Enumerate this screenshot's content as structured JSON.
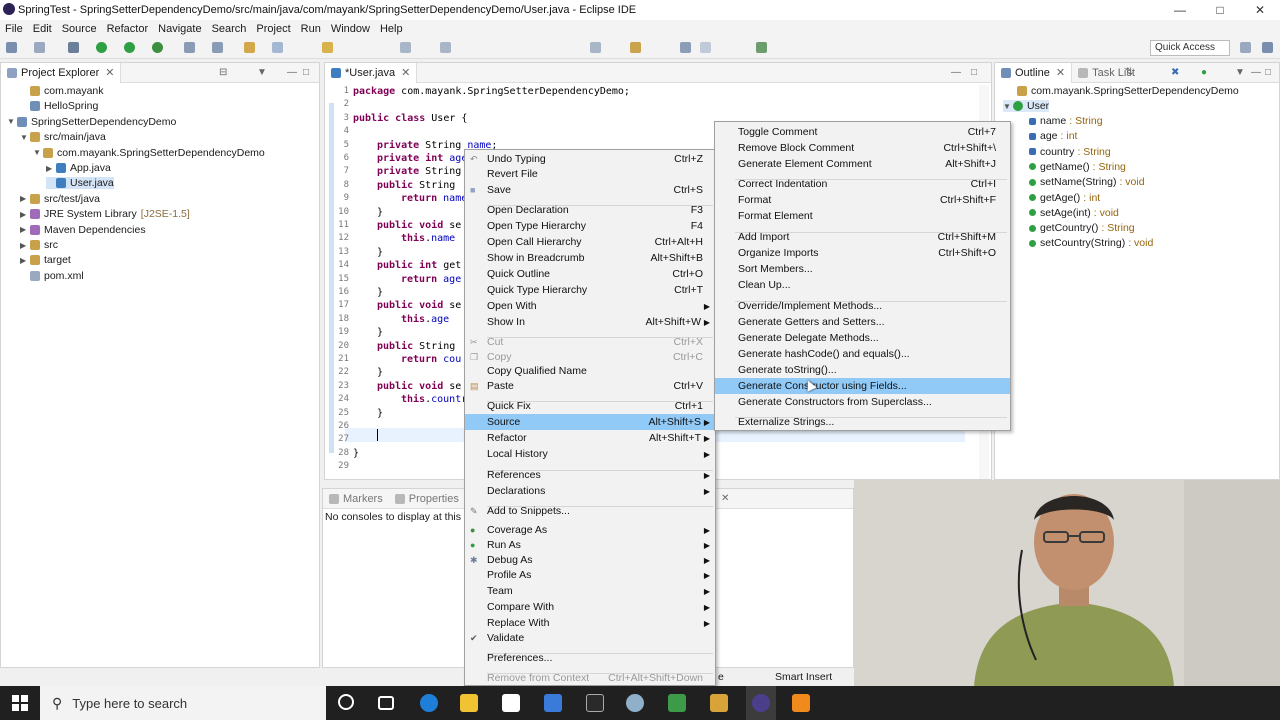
{
  "window": {
    "title": "SpringTest - SpringSetterDependencyDemo/src/main/java/com/mayank/SpringSetterDependencyDemo/User.java - Eclipse IDE"
  },
  "menubar": [
    "File",
    "Edit",
    "Source",
    "Refactor",
    "Navigate",
    "Search",
    "Project",
    "Run",
    "Window",
    "Help"
  ],
  "toolbar": {
    "quick_access": "Quick Access"
  },
  "project_explorer": {
    "title": "Project Explorer",
    "items": [
      {
        "label": "com.mayank",
        "indent": 1
      },
      {
        "label": "HelloSpring",
        "indent": 1
      },
      {
        "label": "SpringSetterDependencyDemo",
        "indent": 0
      },
      {
        "label": "src/main/java",
        "indent": 1
      },
      {
        "label": "com.mayank.SpringSetterDependencyDemo",
        "indent": 2
      },
      {
        "label": "App.java",
        "indent": 3
      },
      {
        "label": "User.java",
        "indent": 3
      },
      {
        "label": "src/test/java",
        "indent": 1
      },
      {
        "label": "JRE System Library",
        "suffix": "[J2SE-1.5]",
        "indent": 1
      },
      {
        "label": "Maven Dependencies",
        "indent": 1
      },
      {
        "label": "src",
        "indent": 1
      },
      {
        "label": "target",
        "indent": 1
      },
      {
        "label": "pom.xml",
        "indent": 1
      }
    ]
  },
  "editor": {
    "tab": "*User.java",
    "line_numbers": [
      "1",
      "2",
      "3",
      "4",
      "5",
      "6",
      "7",
      "8",
      "9",
      "10",
      "11",
      "12",
      "13",
      "14",
      "15",
      "16",
      "17",
      "18",
      "19",
      "20",
      "21",
      "22",
      "23",
      "24",
      "25",
      "26",
      "27",
      "28",
      "29"
    ],
    "package_line": "package com.mayank.SpringSetterDependencyDemo;",
    "class_line": "public class User {",
    "code": [
      "private String name;",
      "private int age",
      "private String",
      "public String",
      "return name",
      "}",
      "public void se",
      "this.name",
      "}",
      "public int get",
      "return age",
      "}",
      "public void se",
      "this.age",
      "}",
      "public String",
      "return cou",
      "}",
      "public void se",
      "this.countr",
      "}",
      "}"
    ]
  },
  "outline": {
    "tabs": [
      "Outline",
      "Task List"
    ],
    "package": "com.mayank.SpringSetterDependencyDemo",
    "class": "User",
    "members": [
      {
        "name": "name",
        "type": ": String"
      },
      {
        "name": "age",
        "type": ": int"
      },
      {
        "name": "country",
        "type": ": String"
      },
      {
        "name": "getName()",
        "type": ": String"
      },
      {
        "name": "setName(String)",
        "type": ": void"
      },
      {
        "name": "getAge()",
        "type": ": int"
      },
      {
        "name": "setAge(int)",
        "type": ": void"
      },
      {
        "name": "getCountry()",
        "type": ": String"
      },
      {
        "name": "setCountry(String)",
        "type": ": void"
      }
    ]
  },
  "bottom_panel": {
    "tabs": [
      "Markers",
      "Properties"
    ],
    "console_message": "No consoles to display at this ti"
  },
  "context_menu": {
    "items": [
      {
        "label": "Undo Typing",
        "shortcut": "Ctrl+Z",
        "icon": "undo-icon"
      },
      {
        "label": "Revert File",
        "shortcut": ""
      },
      {
        "label": "Save",
        "shortcut": "Ctrl+S",
        "icon": "save-icon"
      },
      {
        "label": "Open Declaration",
        "shortcut": "F3"
      },
      {
        "label": "Open Type Hierarchy",
        "shortcut": "F4"
      },
      {
        "label": "Open Call Hierarchy",
        "shortcut": "Ctrl+Alt+H"
      },
      {
        "label": "Show in Breadcrumb",
        "shortcut": "Alt+Shift+B"
      },
      {
        "label": "Quick Outline",
        "shortcut": "Ctrl+O"
      },
      {
        "label": "Quick Type Hierarchy",
        "shortcut": "Ctrl+T"
      },
      {
        "label": "Open With",
        "shortcut": "",
        "submenu": true
      },
      {
        "label": "Show In",
        "shortcut": "Alt+Shift+W",
        "submenu": true
      },
      {
        "label": "Cut",
        "shortcut": "Ctrl+X",
        "disabled": true,
        "icon": "cut-icon"
      },
      {
        "label": "Copy",
        "shortcut": "Ctrl+C",
        "disabled": true,
        "icon": "copy-icon"
      },
      {
        "label": "Copy Qualified Name",
        "shortcut": ""
      },
      {
        "label": "Paste",
        "shortcut": "Ctrl+V",
        "icon": "paste-icon"
      },
      {
        "label": "Quick Fix",
        "shortcut": "Ctrl+1"
      },
      {
        "label": "Source",
        "shortcut": "Alt+Shift+S",
        "submenu": true,
        "highlight": true
      },
      {
        "label": "Refactor",
        "shortcut": "Alt+Shift+T",
        "submenu": true
      },
      {
        "label": "Local History",
        "shortcut": "",
        "submenu": true
      },
      {
        "label": "References",
        "shortcut": "",
        "submenu": true
      },
      {
        "label": "Declarations",
        "shortcut": "",
        "submenu": true
      },
      {
        "label": "Add to Snippets...",
        "shortcut": "",
        "icon": "snippet-icon"
      },
      {
        "label": "Coverage As",
        "shortcut": "",
        "submenu": true,
        "icon": "coverage-icon"
      },
      {
        "label": "Run As",
        "shortcut": "",
        "submenu": true,
        "icon": "run-icon"
      },
      {
        "label": "Debug As",
        "shortcut": "",
        "submenu": true,
        "icon": "debug-icon"
      },
      {
        "label": "Profile As",
        "shortcut": "",
        "submenu": true
      },
      {
        "label": "Team",
        "shortcut": "",
        "submenu": true
      },
      {
        "label": "Compare With",
        "shortcut": "",
        "submenu": true
      },
      {
        "label": "Replace With",
        "shortcut": "",
        "submenu": true
      },
      {
        "label": "Validate",
        "shortcut": "",
        "icon": "check-icon"
      },
      {
        "label": "Preferences...",
        "shortcut": ""
      },
      {
        "label": "Remove from Context",
        "shortcut": "Ctrl+Alt+Shift+Down",
        "disabled": true
      }
    ]
  },
  "source_submenu": {
    "items": [
      {
        "label": "Toggle Comment",
        "shortcut": "Ctrl+7"
      },
      {
        "label": "Remove Block Comment",
        "shortcut": "Ctrl+Shift+\\"
      },
      {
        "label": "Generate Element Comment",
        "shortcut": "Alt+Shift+J"
      },
      {
        "label": "Correct Indentation",
        "shortcut": "Ctrl+I"
      },
      {
        "label": "Format",
        "shortcut": "Ctrl+Shift+F"
      },
      {
        "label": "Format Element",
        "shortcut": ""
      },
      {
        "label": "Add Import",
        "shortcut": "Ctrl+Shift+M"
      },
      {
        "label": "Organize Imports",
        "shortcut": "Ctrl+Shift+O"
      },
      {
        "label": "Sort Members...",
        "shortcut": ""
      },
      {
        "label": "Clean Up...",
        "shortcut": ""
      },
      {
        "label": "Override/Implement Methods...",
        "shortcut": ""
      },
      {
        "label": "Generate Getters and Setters...",
        "shortcut": ""
      },
      {
        "label": "Generate Delegate Methods...",
        "shortcut": ""
      },
      {
        "label": "Generate hashCode() and equals()...",
        "shortcut": ""
      },
      {
        "label": "Generate toString()...",
        "shortcut": ""
      },
      {
        "label": "Generate Constructor using Fields...",
        "shortcut": "",
        "highlight": true
      },
      {
        "label": "Generate Constructors from Superclass...",
        "shortcut": ""
      },
      {
        "label": "Externalize Strings...",
        "shortcut": ""
      }
    ]
  },
  "statusbar": {
    "insert_mode": "Smart Insert",
    "fragment": "e"
  },
  "taskbar": {
    "search_placeholder": "Type here to search"
  },
  "colors": {
    "highlight": "#91c9f7",
    "keyword": "#7f0055",
    "field": "#0000c0",
    "taskbar": "#202020"
  }
}
